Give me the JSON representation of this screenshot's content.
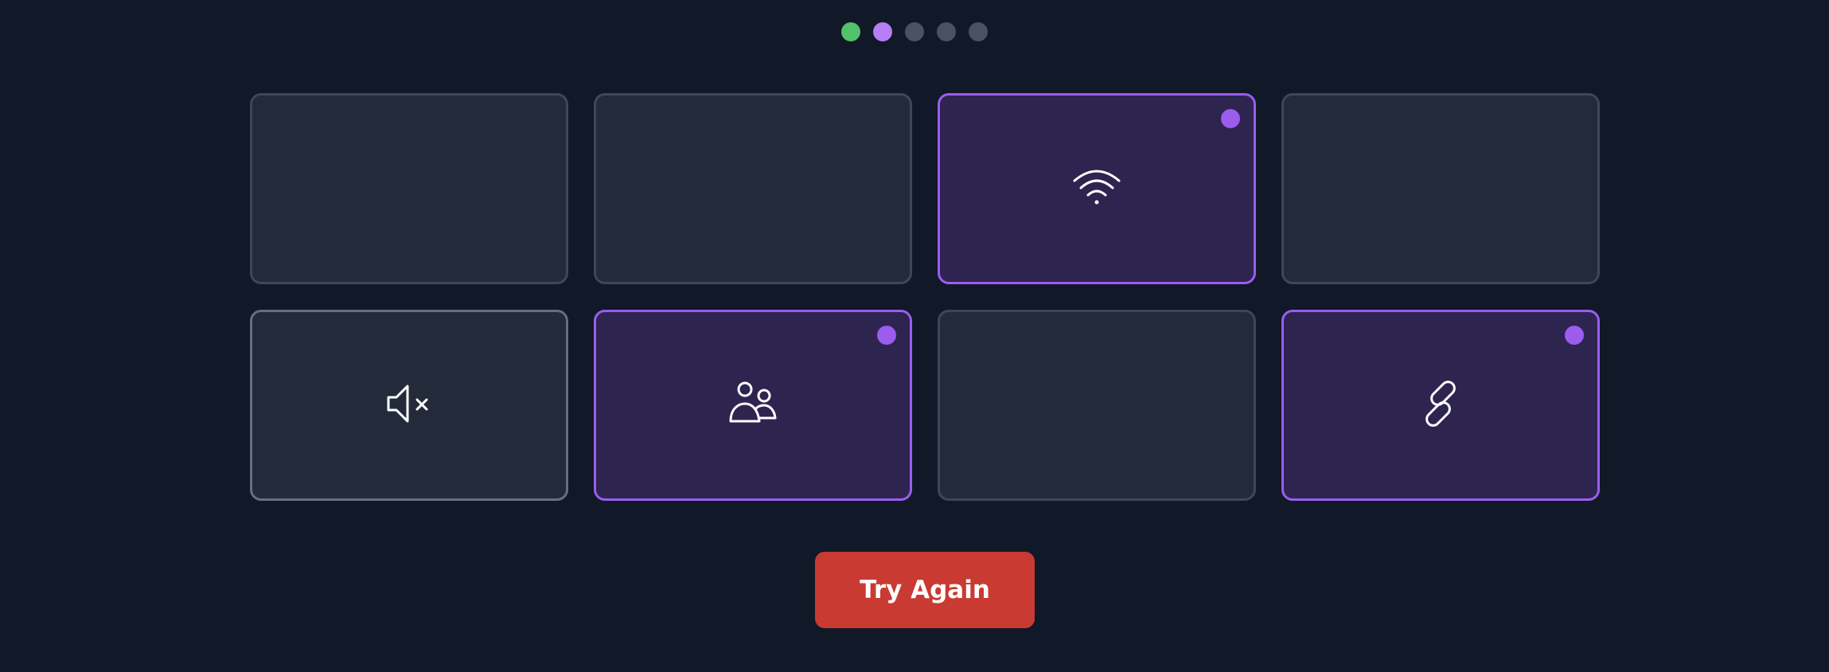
{
  "progress": {
    "steps": [
      {
        "state": "done",
        "color": "#52c16a"
      },
      {
        "state": "current",
        "color": "#b57ef6"
      },
      {
        "state": "todo",
        "color": "#4a5160"
      },
      {
        "state": "todo",
        "color": "#4a5160"
      },
      {
        "state": "todo",
        "color": "#4a5160"
      }
    ]
  },
  "tiles": [
    {
      "state": "hidden",
      "icon": null
    },
    {
      "state": "hidden",
      "icon": null
    },
    {
      "state": "selected",
      "icon": "wifi-icon"
    },
    {
      "state": "hidden",
      "icon": null
    },
    {
      "state": "revealed",
      "icon": "speaker-mute-icon"
    },
    {
      "state": "selected",
      "icon": "users-icon"
    },
    {
      "state": "hidden",
      "icon": null
    },
    {
      "state": "selected",
      "icon": "link-icon"
    }
  ],
  "colors": {
    "background": "#111827",
    "tile": "#232b3b",
    "tile_selected": "#2e2450",
    "accent": "#9b5cf0",
    "button": "#c93a33"
  },
  "button": {
    "label": "Try Again"
  }
}
